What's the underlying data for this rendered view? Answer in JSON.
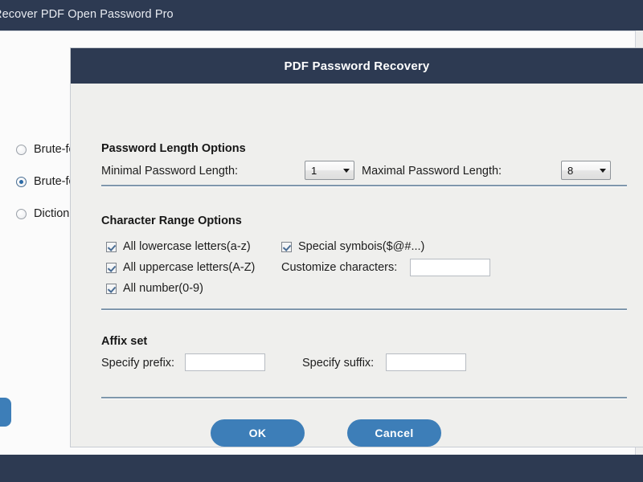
{
  "app": {
    "title": "Recover PDF Open Password Pro",
    "modes": [
      {
        "label": "Brute-fo",
        "selected": false
      },
      {
        "label": "Brute-fo",
        "selected": true
      },
      {
        "label": "Dictiona",
        "selected": false
      }
    ]
  },
  "dialog": {
    "title": "PDF Password Recovery",
    "length_section": {
      "heading": "Password Length Options",
      "min_label": "Minimal Password Length:",
      "min_value": "1",
      "max_label": "Maximal Password Length:",
      "max_value": "8"
    },
    "charset_section": {
      "heading": "Character Range Options",
      "options": [
        {
          "label": "All lowercase letters(a-z)",
          "checked": true
        },
        {
          "label": "All uppercase letters(A-Z)",
          "checked": true
        },
        {
          "label": "All number(0-9)",
          "checked": true
        },
        {
          "label": "Special symbois($@#...)",
          "checked": true
        }
      ],
      "customize_label": "Customize characters:",
      "customize_value": ""
    },
    "affix_section": {
      "heading": "Affix set",
      "prefix_label": "Specify prefix:",
      "prefix_value": "",
      "suffix_label": "Specify suffix:",
      "suffix_value": ""
    },
    "ok_label": "OK",
    "cancel_label": "Cancel"
  },
  "colors": {
    "navy": "#2d3a52",
    "accent_blue": "#3d7eb8",
    "dialog_bg": "#efefed",
    "separator": "#7f97ac"
  }
}
